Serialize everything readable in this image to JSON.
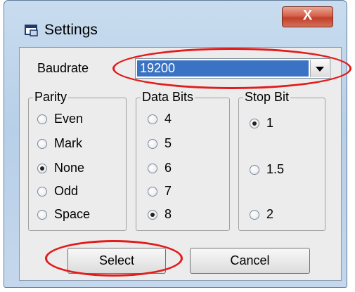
{
  "window": {
    "title": "Settings",
    "close_label": "X"
  },
  "baudrate": {
    "label": "Baudrate",
    "value": "19200"
  },
  "parity": {
    "title": "Parity",
    "options": [
      {
        "label": "Even",
        "checked": false
      },
      {
        "label": "Mark",
        "checked": false
      },
      {
        "label": "None",
        "checked": true
      },
      {
        "label": "Odd",
        "checked": false
      },
      {
        "label": "Space",
        "checked": false
      }
    ]
  },
  "data_bits": {
    "title": "Data Bits",
    "options": [
      {
        "label": "4",
        "checked": false
      },
      {
        "label": "5",
        "checked": false
      },
      {
        "label": "6",
        "checked": false
      },
      {
        "label": "7",
        "checked": false
      },
      {
        "label": "8",
        "checked": true
      }
    ]
  },
  "stop_bit": {
    "title": "Stop Bit",
    "options": [
      {
        "label": "1",
        "checked": true
      },
      {
        "label": "1.5",
        "checked": false
      },
      {
        "label": "2",
        "checked": false
      }
    ]
  },
  "buttons": {
    "select_label": "Select",
    "cancel_label": "Cancel"
  },
  "colors": {
    "highlight": "#e21b1b",
    "selection": "#3b73c4"
  }
}
